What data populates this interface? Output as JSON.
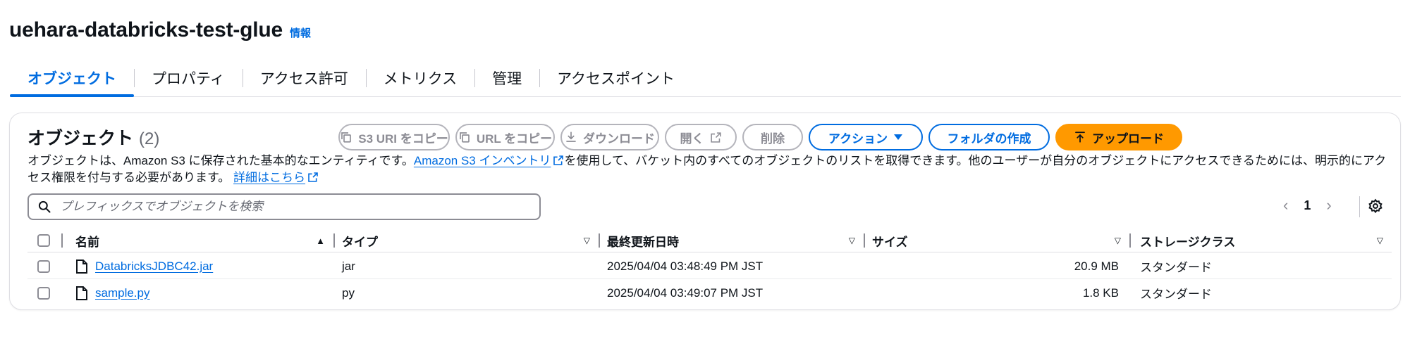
{
  "header": {
    "bucket_name": "uehara-databricks-test-glue",
    "info_label": "情報"
  },
  "tabs": [
    {
      "label": "オブジェクト",
      "active": true
    },
    {
      "label": "プロパティ"
    },
    {
      "label": "アクセス許可"
    },
    {
      "label": "メトリクス"
    },
    {
      "label": "管理"
    },
    {
      "label": "アクセスポイント"
    }
  ],
  "panel": {
    "title": "オブジェクト",
    "count": "(2)",
    "description_pre": "オブジェクトは、Amazon S3 に保存された基本的なエンティティです。",
    "inventory_link": "Amazon S3 インベントリ",
    "description_mid": "を使用して、バケット内のすべてのオブジェクトのリストを取得できます。他のユーザーが自分のオブジェクトにアクセスできるためには、明示的にアクセス権限を付与する必要があります。",
    "details_link": "詳細はこちら"
  },
  "toolbar": {
    "copy_s3_uri": "S3 URI をコピー",
    "copy_url": "URL をコピー",
    "download": "ダウンロード",
    "open": "開く",
    "delete": "削除",
    "actions": "アクション",
    "create_folder": "フォルダの作成",
    "upload": "アップロード"
  },
  "search": {
    "placeholder": "プレフィックスでオブジェクトを検索"
  },
  "pagination": {
    "current_page": "1"
  },
  "table": {
    "headers": {
      "name": "名前",
      "type": "タイプ",
      "modified": "最終更新日時",
      "size": "サイズ",
      "storage": "ストレージクラス"
    },
    "rows": [
      {
        "name": "DatabricksJDBC42.jar",
        "type": "jar",
        "modified": "2025/04/04 03:48:49 PM JST",
        "size": "20.9 MB",
        "storage": "スタンダード"
      },
      {
        "name": "sample.py",
        "type": "py",
        "modified": "2025/04/04 03:49:07 PM JST",
        "size": "1.8 KB",
        "storage": "スタンダード"
      }
    ]
  },
  "colors": {
    "accent": "#006ce0",
    "primary_button": "#ff9900",
    "disabled": "#8c8c94"
  }
}
